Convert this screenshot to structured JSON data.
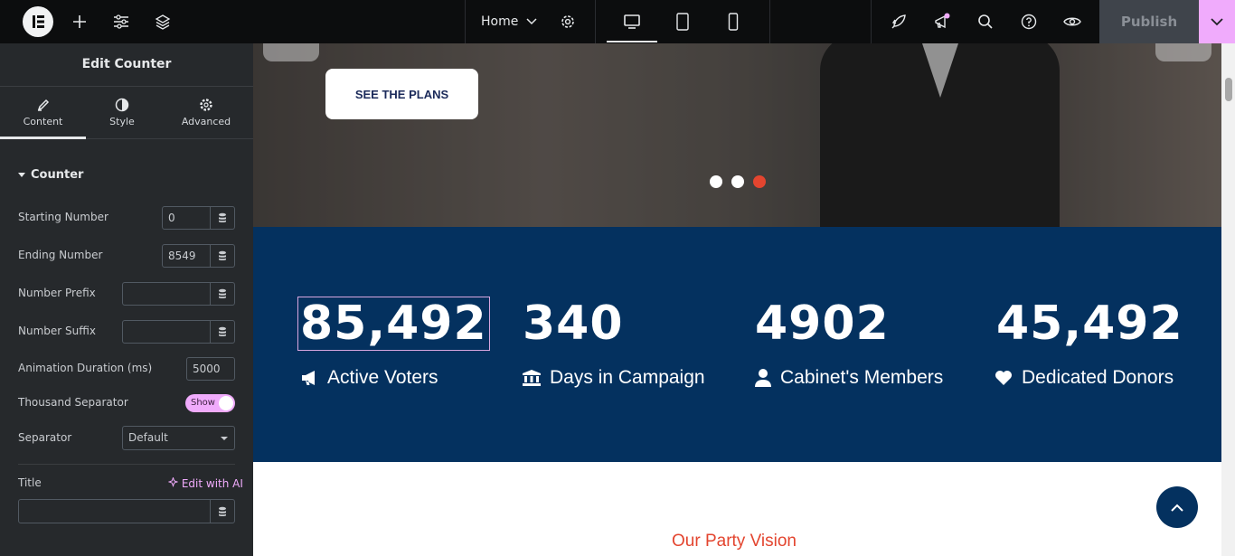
{
  "topbar": {
    "home_label": "Home",
    "publish_label": "Publish",
    "icons": [
      "elementor-logo-icon",
      "add-icon",
      "settings-sliders-icon",
      "layers-icon",
      "chevron-down-icon",
      "gear-icon",
      "desktop-icon",
      "tablet-icon",
      "mobile-icon",
      "rocket-icon",
      "megaphone-icon",
      "search-icon",
      "help-icon",
      "eye-icon",
      "chevron-down-icon"
    ],
    "accent": "#f0abfc"
  },
  "panel": {
    "title": "Edit Counter",
    "tabs": [
      {
        "label": "Content",
        "icon": "pencil-icon",
        "active": true
      },
      {
        "label": "Style",
        "icon": "half-circle-icon"
      },
      {
        "label": "Advanced",
        "icon": "gear-icon"
      }
    ],
    "section": "Counter",
    "controls": {
      "starting_number": {
        "label": "Starting Number",
        "value": "0"
      },
      "ending_number": {
        "label": "Ending Number",
        "value": "8549"
      },
      "number_prefix": {
        "label": "Number Prefix",
        "value": ""
      },
      "number_suffix": {
        "label": "Number Suffix",
        "value": ""
      },
      "animation_duration": {
        "label": "Animation Duration (ms)",
        "value": "5000"
      },
      "thousand_separator": {
        "label": "Thousand Separator",
        "value": "Show"
      },
      "separator": {
        "label": "Separator",
        "value": "Default"
      },
      "title": {
        "label": "Title",
        "value": "",
        "ai_label": "Edit with AI"
      }
    }
  },
  "canvas": {
    "hero": {
      "button_label": "SEE THE PLANS",
      "dots_active": 3
    },
    "stats": [
      {
        "number": "85,492",
        "title": "Active Voters",
        "icon": "megaphone-icon"
      },
      {
        "number": "340",
        "title": "Days in Campaign",
        "icon": "bank-icon"
      },
      {
        "number": "4902",
        "title": "Cabinet's Members",
        "icon": "user-icon"
      },
      {
        "number": "45,492",
        "title": "Dedicated Donors",
        "icon": "heart-icon"
      }
    ],
    "vision_heading": "Our Party Vision",
    "colors": {
      "stats_bg": "#04315f",
      "vision": "#e3452f",
      "dot_active": "#e3452f"
    }
  }
}
